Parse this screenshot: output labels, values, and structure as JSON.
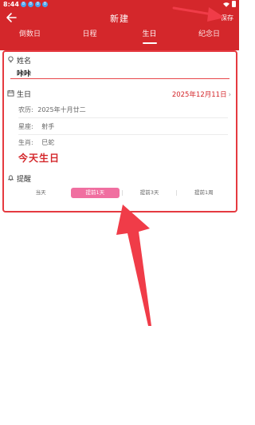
{
  "status_bar": {
    "time": "8:44",
    "notification_dots": [
      "8",
      "8",
      "8",
      "8"
    ]
  },
  "header": {
    "title": "新建",
    "save_label": "保存",
    "back_icon": "arrow-left-icon"
  },
  "tabs": [
    {
      "label": "倒数日",
      "active": false
    },
    {
      "label": "日程",
      "active": false
    },
    {
      "label": "生日",
      "active": true
    },
    {
      "label": "纪念日",
      "active": false
    }
  ],
  "form": {
    "name_label": "姓名",
    "name_value": "咔咔",
    "birthday_label": "生日",
    "birthday_value": "2025年12月11日",
    "chevron": "›",
    "lunar_label": "农历:",
    "lunar_value": "2025年十月廿二",
    "zodiac_label": "星座:",
    "zodiac_value": "射手",
    "animal_label": "生肖:",
    "animal_value": "巳蛇",
    "today_text": "今天生日",
    "reminder_label": "提醒",
    "reminder_options": [
      {
        "label": "当天",
        "active": false
      },
      {
        "label": "提前1天",
        "active": true
      },
      {
        "label": "提前3天",
        "active": false
      },
      {
        "label": "提前1周",
        "active": false
      }
    ]
  },
  "colors": {
    "header": "#d4272b",
    "accent": "#e53a40",
    "active_pill": "#f06fa0",
    "annotation_arrow": "#f03c48"
  }
}
